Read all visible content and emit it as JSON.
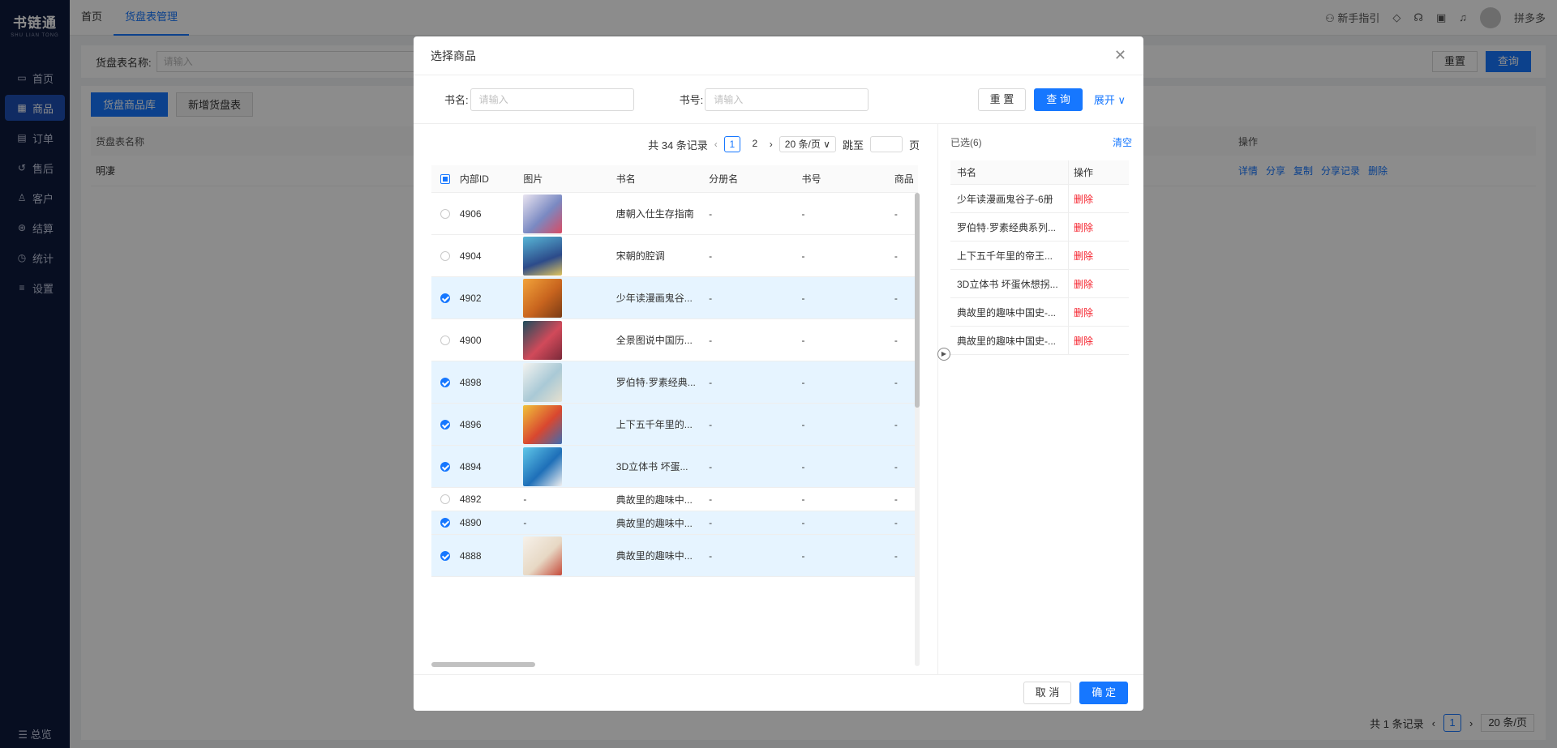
{
  "app": {
    "logo_title": "书链通",
    "logo_sub": "SHU LIAN TONG",
    "nav": [
      {
        "icon": "▭",
        "label": "首页"
      },
      {
        "icon": "▦",
        "label": "商品"
      },
      {
        "icon": "▤",
        "label": "订单"
      },
      {
        "icon": "↺",
        "label": "售后"
      },
      {
        "icon": "♙",
        "label": "客户"
      },
      {
        "icon": "⊛",
        "label": "结算"
      },
      {
        "icon": "◷",
        "label": "统计"
      },
      {
        "icon": "≡",
        "label": "设置"
      }
    ],
    "nav_bottom": "☰ 总览",
    "tabs": [
      "首页",
      "货盘表管理"
    ],
    "guide": "新手指引",
    "user": "拼多多"
  },
  "bg": {
    "search_label": "货盘表名称:",
    "search_placeholder": "请输入",
    "reset": "重置",
    "query": "查询",
    "subtabs": [
      "货盘商品库",
      "新增货盘表"
    ],
    "col_name": "货盘表名称",
    "col_ops": "操作",
    "row_name": "明凄",
    "row_ops": [
      "详情",
      "分享",
      "复制",
      "分享记录",
      "删除"
    ],
    "total": "共 1 条记录",
    "page": "1",
    "page_size": "20 条/页"
  },
  "modal": {
    "title": "选择商品",
    "filter": {
      "book_name_label": "书名:",
      "book_name_placeholder": "请输入",
      "book_no_label": "书号:",
      "book_no_placeholder": "请输入",
      "reset": "重 置",
      "query": "查 询",
      "expand": "展开 ∨"
    },
    "pager": {
      "total": "共 34 条记录",
      "pages": [
        "1",
        "2"
      ],
      "page_size": "20 条/页",
      "jump_label": "跳至",
      "page_unit": "页"
    },
    "columns": [
      "内部ID",
      "图片",
      "书名",
      "分册名",
      "书号",
      "商品"
    ],
    "rows": [
      {
        "id": "4906",
        "name": "唐朝入仕生存指南",
        "sub": "-",
        "no": "-",
        "goods": "-",
        "checked": false,
        "img": "thumb-1"
      },
      {
        "id": "4904",
        "name": "宋朝的腔调",
        "sub": "-",
        "no": "-",
        "goods": "-",
        "checked": false,
        "img": "thumb-2"
      },
      {
        "id": "4902",
        "name": "少年读漫画鬼谷...",
        "sub": "-",
        "no": "-",
        "goods": "-",
        "checked": true,
        "img": "thumb-3"
      },
      {
        "id": "4900",
        "name": "全景图说中国历...",
        "sub": "-",
        "no": "-",
        "goods": "-",
        "checked": false,
        "img": "thumb-4"
      },
      {
        "id": "4898",
        "name": "罗伯特·罗素经典...",
        "sub": "-",
        "no": "-",
        "goods": "-",
        "checked": true,
        "img": "thumb-5"
      },
      {
        "id": "4896",
        "name": "上下五千年里的...",
        "sub": "-",
        "no": "-",
        "goods": "-",
        "checked": true,
        "img": "thumb-6"
      },
      {
        "id": "4894",
        "name": "3D立体书 坏蛋...",
        "sub": "-",
        "no": "-",
        "goods": "-",
        "checked": true,
        "img": "thumb-7"
      },
      {
        "id": "4892",
        "name": "典故里的趣味中...",
        "sub": "-",
        "no": "-",
        "goods": "-",
        "checked": false,
        "img": "-"
      },
      {
        "id": "4890",
        "name": "典故里的趣味中...",
        "sub": "-",
        "no": "-",
        "goods": "-",
        "checked": true,
        "img": "-"
      },
      {
        "id": "4888",
        "name": "典故里的趣味中...",
        "sub": "-",
        "no": "-",
        "goods": "-",
        "checked": true,
        "img": "thumb-8"
      }
    ],
    "selected": {
      "title": "已选(6)",
      "clear": "清空",
      "col_name": "书名",
      "col_op": "操作",
      "delete": "删除",
      "items": [
        "少年读漫画鬼谷子-6册",
        "罗伯特·罗素经典系列...",
        "上下五千年里的帝王...",
        "3D立体书 坏蛋休想拐...",
        "典故里的趣味中国史-...",
        "典故里的趣味中国史-..."
      ]
    },
    "footer": {
      "cancel": "取 消",
      "ok": "确 定"
    }
  },
  "colors": {
    "primary": "#1677ff",
    "sidebar": "#0e1a3d",
    "danger": "#f5222d",
    "selected_row": "#e6f4ff"
  }
}
